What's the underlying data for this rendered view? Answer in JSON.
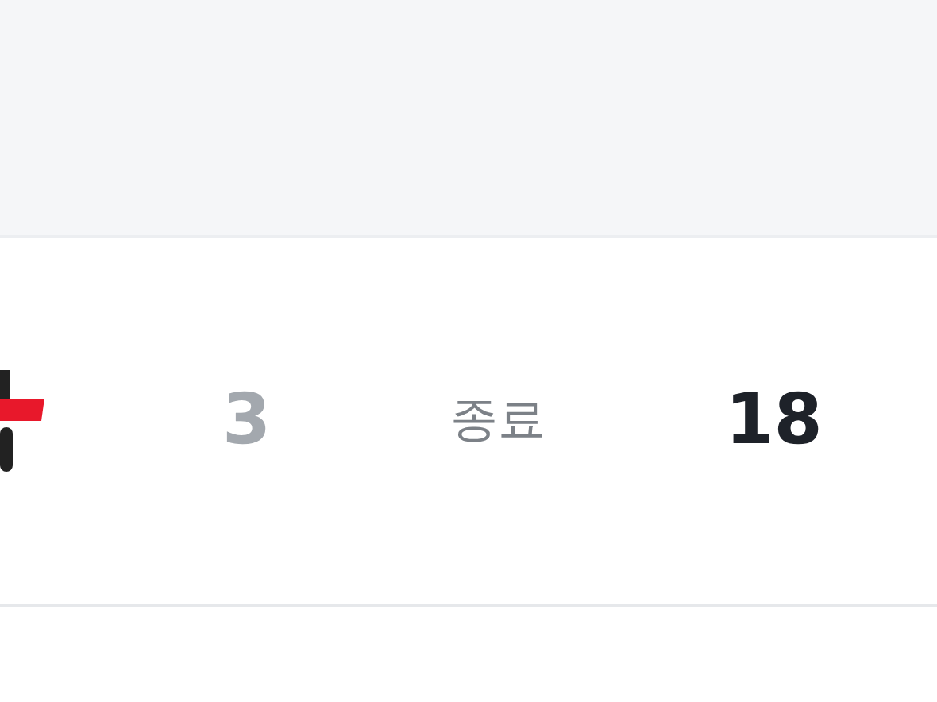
{
  "game": {
    "status": "종료",
    "scores": [
      {
        "score": "3",
        "winner": false
      },
      {
        "score": "18",
        "winner": true
      }
    ]
  }
}
